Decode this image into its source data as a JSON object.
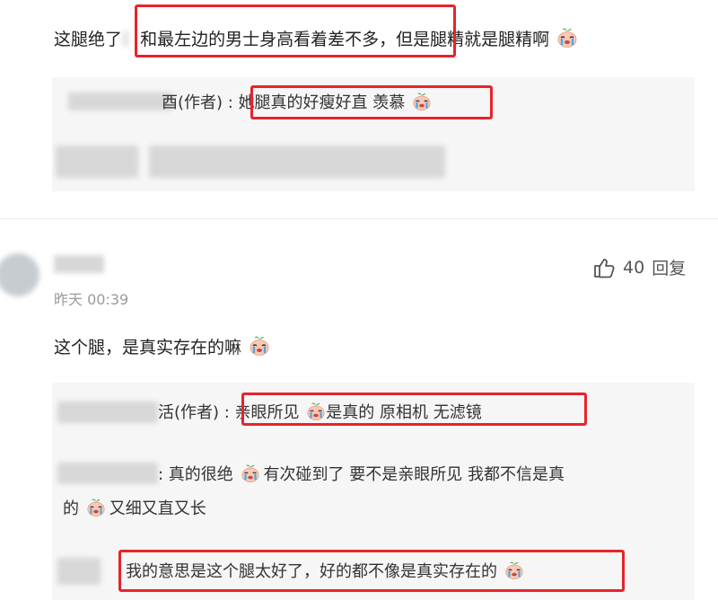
{
  "comment1": {
    "text_prefix": "这腿绝了",
    "text_highlight": "和最左边的男士身高看着差不多，",
    "text_suffix": "但是腿精就是腿精啊",
    "replies": [
      {
        "author_suffix": "酉(作者) : ",
        "text": "她腿真的好瘦好直 羡慕"
      }
    ]
  },
  "comment2": {
    "timestamp": "昨天 00:39",
    "likes": "40",
    "reply_label": "回复",
    "text": "这个腿，是真实存在的嘛",
    "replies": [
      {
        "author_suffix": "活(作者) : ",
        "text_a": "亲眼所见",
        "text_b": "是真的 原相机 无滤镜"
      },
      {
        "author_suffix": " : ",
        "text_a": "真的很绝",
        "text_b": "有次碰到了 要不是亲眼所见 我都不信是真",
        "text_c": "的",
        "text_d": "又细又直又长"
      },
      {
        "author_suffix": "",
        "text": "我的意思是这个腿太好了，好的都不像是真实存在的"
      }
    ]
  },
  "icons": {
    "emoji": "crying-face-sprout-emoji",
    "like": "thumbs-up-icon"
  },
  "colors": {
    "highlight": "#e8232a",
    "panel": "#f6f6f7"
  }
}
